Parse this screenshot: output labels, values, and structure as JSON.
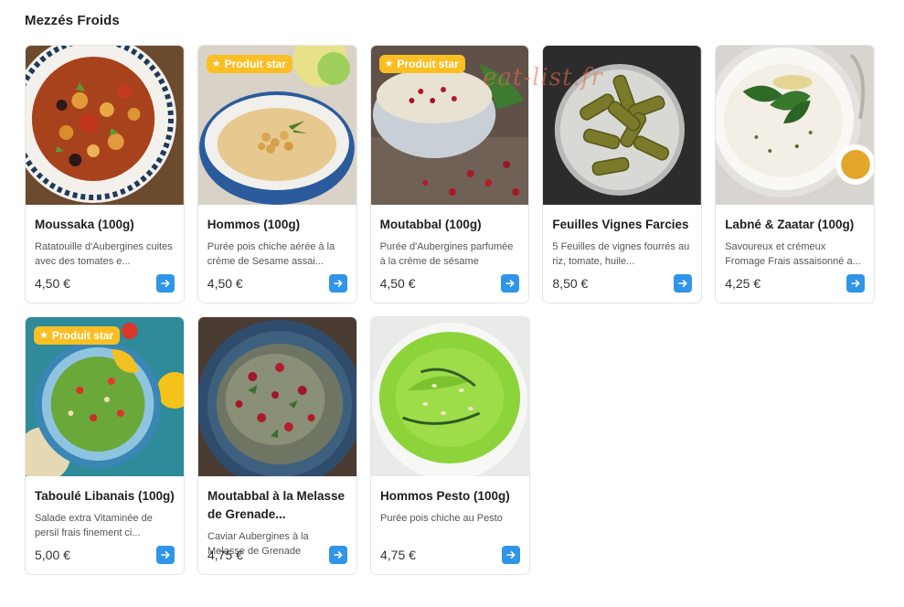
{
  "section": {
    "title": "Mezzés Froids"
  },
  "watermark": "eat-list.fr",
  "badge_label": "Produit star",
  "colors": {
    "accent": "#2f95e8",
    "badge": "#fbbf24"
  },
  "items": [
    {
      "title": "Moussaka (100g)",
      "description": "Ratatouille d'Aubergines cuites avec des tomates e...",
      "price": "4,50 €",
      "star": false
    },
    {
      "title": "Hommos (100g)",
      "description": "Purée pois chiche aérée à la crème de Sesame assai...",
      "price": "4,50 €",
      "star": true
    },
    {
      "title": "Moutabbal (100g)",
      "description": "Purée d'Aubergines parfumée à la crème de sésame",
      "price": "4,50 €",
      "star": true
    },
    {
      "title": "Feuilles Vignes Farcies",
      "description": "5 Feuilles de vignes fourrés au riz, tomate, huile...",
      "price": "8,50 €",
      "star": false
    },
    {
      "title": "Labné & Zaatar (100g)",
      "description": "Savoureux et crémeux Fromage Frais assaisonné a...",
      "price": "4,25 €",
      "star": false
    },
    {
      "title": "Taboulé Libanais (100g)",
      "description": "Salade extra Vitaminée de persil frais finement ci...",
      "price": "5,00 €",
      "star": true
    },
    {
      "title": "Moutabbal à la Melasse de Grenade...",
      "description": "Caviar Aubergines à la Melasse de Grenade",
      "price": "4,75 €",
      "star": false
    },
    {
      "title": "Hommos Pesto (100g)",
      "description": "Purée pois chiche au Pesto",
      "price": "4,75 €",
      "star": false
    }
  ]
}
